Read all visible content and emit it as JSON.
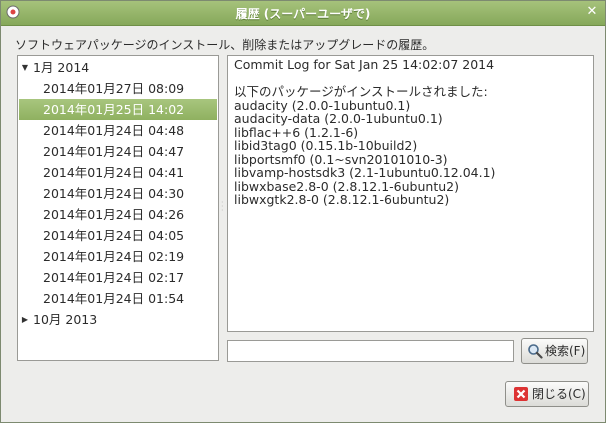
{
  "window": {
    "title": "履歴 (スーパーユーザで)"
  },
  "description": "ソフトウェアパッケージのインストール、削除またはアップグレードの履歴。",
  "tree": {
    "groups": [
      {
        "label": "1月 2014",
        "expanded": true,
        "items": [
          "2014年01月27日 08:09",
          "2014年01月25日 14:02",
          "2014年01月24日 04:48",
          "2014年01月24日 04:47",
          "2014年01月24日 04:41",
          "2014年01月24日 04:30",
          "2014年01月24日 04:26",
          "2014年01月24日 04:05",
          "2014年01月24日 02:19",
          "2014年01月24日 02:17",
          "2014年01月24日 01:54"
        ],
        "selected_index": 1
      },
      {
        "label": "10月 2013",
        "expanded": false,
        "items": []
      }
    ]
  },
  "log": {
    "header": "Commit Log for Sat Jan 25 14:02:07 2014",
    "intro": "以下のパッケージがインストールされました:",
    "packages": [
      "audacity (2.0.0-1ubuntu0.1)",
      "audacity-data (2.0.0-1ubuntu0.1)",
      "libflac++6 (1.2.1-6)",
      "libid3tag0 (0.15.1b-10build2)",
      "libportsmf0 (0.1~svn20101010-3)",
      "libvamp-hostsdk3 (2.1-1ubuntu0.12.04.1)",
      "libwxbase2.8-0 (2.8.12.1-6ubuntu2)",
      "libwxgtk2.8-0 (2.8.12.1-6ubuntu2)"
    ]
  },
  "search": {
    "value": "",
    "button_label": "検索(F)"
  },
  "close_button_label": "閉じる(C)",
  "colors": {
    "selection": "#97b96a",
    "titlebar": "#94b468"
  }
}
